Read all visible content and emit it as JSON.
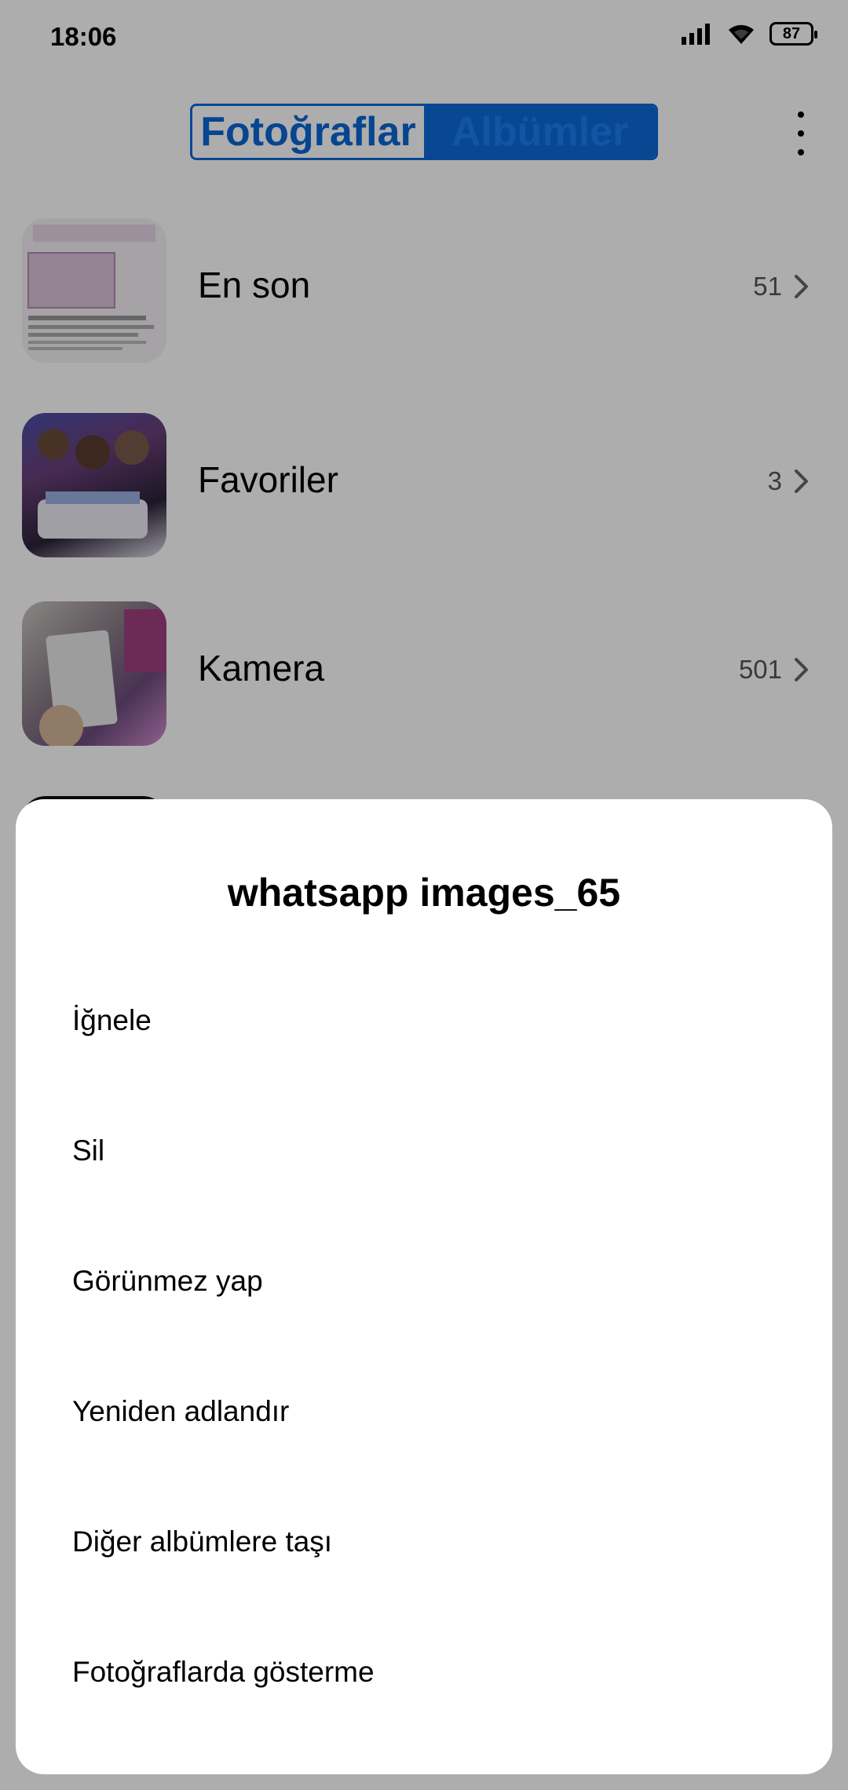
{
  "status_bar": {
    "time": "18:06",
    "battery": "87",
    "icons": [
      "signal-icon",
      "wifi-icon",
      "battery-icon"
    ]
  },
  "header": {
    "tabs": [
      {
        "label": "Fotoğraflar",
        "selected": false
      },
      {
        "label": "Albümler",
        "selected": true
      }
    ],
    "more_icon": "more-vertical-icon"
  },
  "albums": [
    {
      "name": "En son",
      "count": "51"
    },
    {
      "name": "Favoriler",
      "count": "3"
    },
    {
      "name": "Kamera",
      "count": "501"
    }
  ],
  "sheet": {
    "title": "whatsapp images_65",
    "items": [
      "İğnele",
      "Sil",
      "Görünmez yap",
      "Yeniden adlandır",
      "Diğer albümlere taşı",
      "Fotoğraflarda gösterme"
    ]
  },
  "colors": {
    "accent": "#0c6ad8",
    "overlay": "rgba(0,0,0,0.32)"
  }
}
